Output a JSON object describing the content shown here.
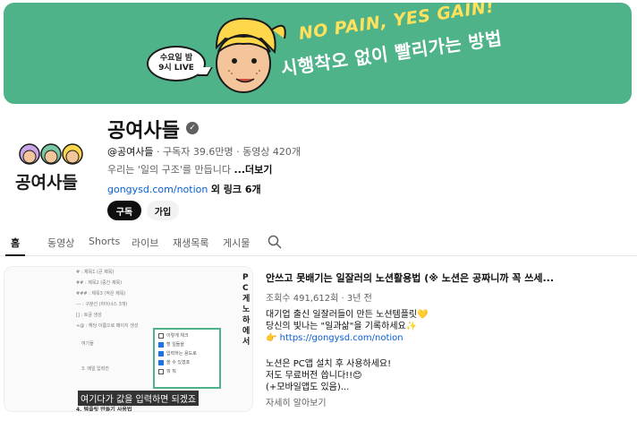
{
  "banner": {
    "bubble_line1": "수요일 밤",
    "bubble_line2": "9시 LIVE",
    "slogan_en": "NO PAIN, YES GAIN!",
    "slogan_ko": "시행착오 없이 빨리가는 방법",
    "bg_color": "#4fb389"
  },
  "channel": {
    "name": "공여사들",
    "verified_icon": "check-icon",
    "handle": "@공여사들",
    "subscribers": "구독자 39.6만명",
    "videos": "동영상 420개",
    "description": "우리는 '일의 구조'를 만듭니다",
    "more_label": "...더보기",
    "link_url": "gongysd.com/notion",
    "link_more": "외 링크 6개",
    "logo_text": "공여사들",
    "subscribe_label": "구독",
    "join_label": "가입"
  },
  "tabs": [
    {
      "label": "홈",
      "active": true
    },
    {
      "label": "동영상"
    },
    {
      "label": "Shorts"
    },
    {
      "label": "라이브"
    },
    {
      "label": "재생목록"
    },
    {
      "label": "게시물"
    }
  ],
  "featured": {
    "title": "안쓰고 못배기는 일잘러의 노션활용법 (※ 노션은 공짜니까 꼭 쓰세...",
    "views": "조회수 491,612회",
    "age": "3년 전",
    "desc_line1": "대기업 출신 일잘러들이 만든 노션템플릿💛",
    "desc_line2": "당신의 빛나는 \"일과삶\"을 기록하세요✨",
    "desc_link": "https://gongysd.com/notion",
    "desc_line3": "노션은 PC앱 설치 후 사용하세요!",
    "desc_line4": "저도 무료버전 씁니다!!😊",
    "desc_line5": "(+모바일앱도 있음)...",
    "more": "자세히 알아보기",
    "thumb": {
      "caption": "여기다가 값을 입력하면 되겠죠",
      "vertical_text": "PC게노하에서",
      "list": [
        "# : 제목1 (큰 제목)",
        "## : 제목2 (중간 제목)",
        "### : 제목3 (작은 제목)",
        "--- : 구분선 (하이너스 3개)",
        "[] : 토글 생성",
        "+@ : 해당 이름으로 페이지 생성"
      ],
      "checklist": [
        "이렇게 체크",
        "할 일들을",
        "입력하는 용도로",
        "쓸 수 있겠죠",
        "뭐 뭐"
      ],
      "checked": [
        false,
        true,
        true,
        true,
        false
      ],
      "side_items": [
        "여기들",
        "3. 매일 입력칸",
        "4. 블럭 다루기"
      ],
      "footer": "4. 템플릿 만들기 사용법"
    }
  }
}
